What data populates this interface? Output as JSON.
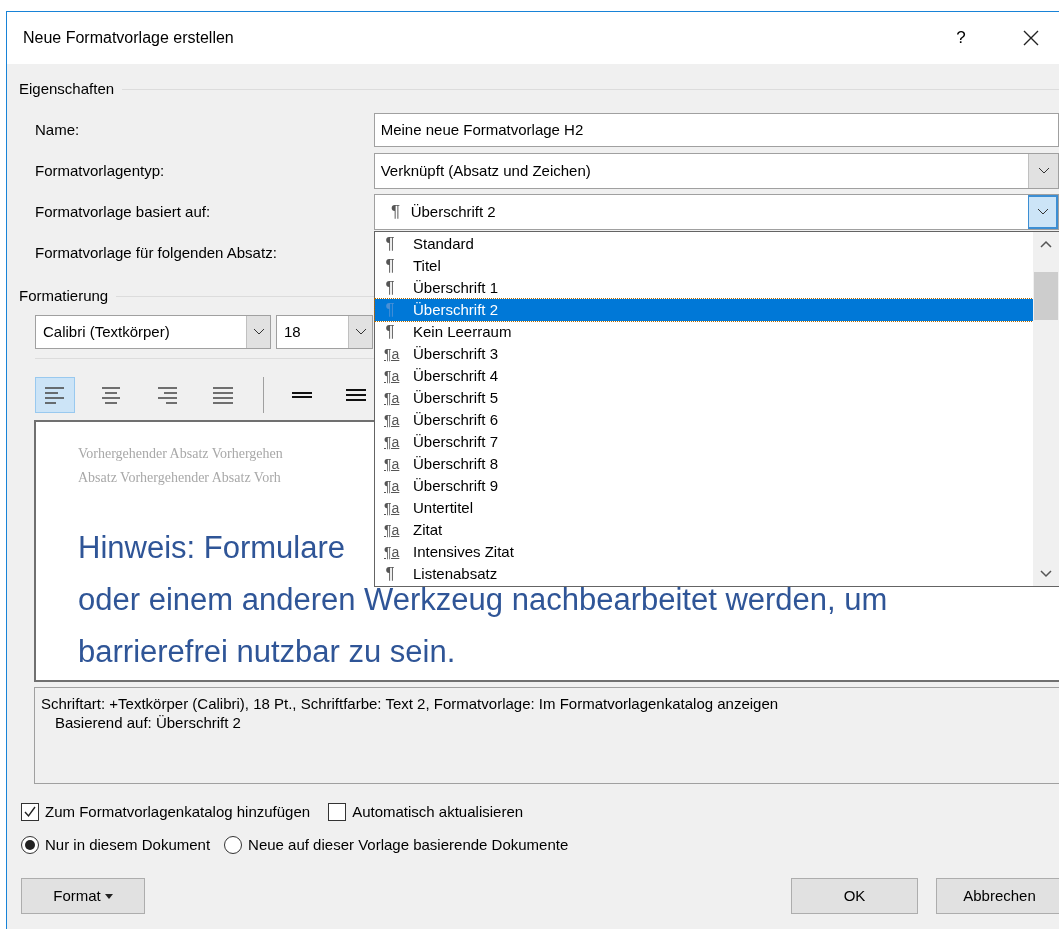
{
  "window": {
    "title": "Neue Formatvorlage erstellen",
    "help": "?"
  },
  "properties": {
    "heading": "Eigenschaften",
    "fields": [
      {
        "label": "Name:",
        "kind": "text",
        "value": "Meine neue Formatvorlage H2"
      },
      {
        "label": "Formatvorlagentyp:",
        "kind": "combo",
        "value": "Verknüpft (Absatz und Zeichen)",
        "open": false
      },
      {
        "label": "Formatvorlage basiert auf:",
        "kind": "combo",
        "mark": "¶",
        "value": "Überschrift 2",
        "open": true
      },
      {
        "label": "Formatvorlage für folgenden Absatz:",
        "kind": "covered"
      }
    ]
  },
  "dropdown": {
    "items": [
      {
        "mark": "¶",
        "kind": "paragraph",
        "label": "Standard",
        "selected": false
      },
      {
        "mark": "¶",
        "kind": "paragraph",
        "label": "Titel",
        "selected": false
      },
      {
        "mark": "¶",
        "kind": "paragraph",
        "label": "Überschrift 1",
        "selected": false
      },
      {
        "mark": "¶",
        "kind": "paragraph",
        "label": "Überschrift 2",
        "selected": true
      },
      {
        "mark": "¶",
        "kind": "paragraph",
        "label": "Kein Leerraum",
        "selected": false
      },
      {
        "mark": "¶a",
        "kind": "linked",
        "label": "Überschrift 3",
        "selected": false
      },
      {
        "mark": "¶a",
        "kind": "linked",
        "label": "Überschrift 4",
        "selected": false
      },
      {
        "mark": "¶a",
        "kind": "linked",
        "label": "Überschrift 5",
        "selected": false
      },
      {
        "mark": "¶a",
        "kind": "linked",
        "label": "Überschrift 6",
        "selected": false
      },
      {
        "mark": "¶a",
        "kind": "linked",
        "label": "Überschrift 7",
        "selected": false
      },
      {
        "mark": "¶a",
        "kind": "linked",
        "label": "Überschrift 8",
        "selected": false
      },
      {
        "mark": "¶a",
        "kind": "linked",
        "label": "Überschrift 9",
        "selected": false
      },
      {
        "mark": "¶a",
        "kind": "linked",
        "label": "Untertitel",
        "selected": false
      },
      {
        "mark": "¶a",
        "kind": "linked",
        "label": "Zitat",
        "selected": false
      },
      {
        "mark": "¶a",
        "kind": "linked",
        "label": "Intensives Zitat",
        "selected": false
      },
      {
        "mark": "¶",
        "kind": "paragraph",
        "label": "Listenabsatz",
        "selected": false
      }
    ]
  },
  "formatting": {
    "heading": "Formatierung",
    "font": "Calibri (Textkörper)",
    "size": "18",
    "alignment_buttons": [
      {
        "kind": "left",
        "selected": true
      },
      {
        "kind": "center",
        "selected": false
      },
      {
        "kind": "right",
        "selected": false
      },
      {
        "kind": "justify",
        "selected": false
      }
    ],
    "spacing_buttons": [
      {
        "kind": "single"
      },
      {
        "kind": "one-half"
      }
    ]
  },
  "preview": {
    "previous_lines": [
      "Vorhergehender Absatz Vorhergehen",
      "Absatz Vorhergehender Absatz Vorh"
    ],
    "heading_lines": [
      "Hinweis: Formulare",
      "oder einem anderen Werkzeug nachbearbeitet werden, um",
      "barrierefrei nutzbar zu sein."
    ]
  },
  "description": {
    "lines": [
      "Schriftart: +Textkörper (Calibri), 18 Pt., Schriftfarbe: Text 2, Formatvorlage: Im Formatvorlagenkatalog anzeigen",
      "Basierend auf: Überschrift 2"
    ]
  },
  "options": {
    "checkboxes": [
      {
        "label": "Zum Formatvorlagenkatalog hinzufügen",
        "checked": true
      },
      {
        "label": "Automatisch aktualisieren",
        "checked": false
      }
    ],
    "radios": [
      {
        "label": "Nur in diesem Dokument",
        "selected": true
      },
      {
        "label": "Neue auf dieser Vorlage basierende Dokumente",
        "selected": false
      }
    ]
  },
  "buttons": [
    {
      "label": "Format",
      "kind": "menu"
    },
    {
      "label": "OK",
      "kind": "plain"
    },
    {
      "label": "Abbrechen",
      "kind": "plain"
    }
  ]
}
